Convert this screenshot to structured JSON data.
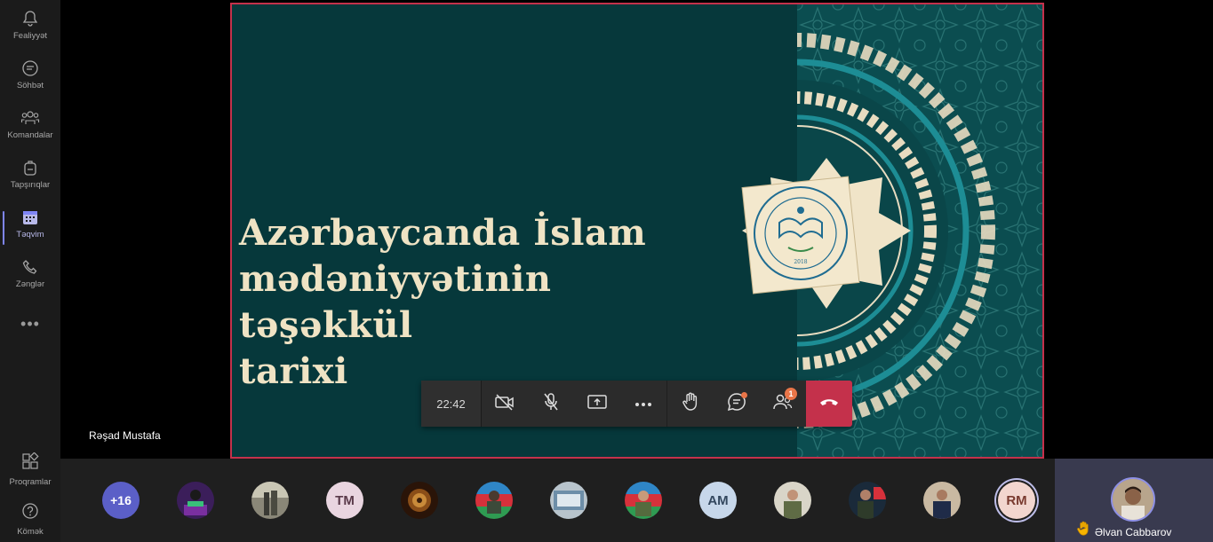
{
  "rail": {
    "items": [
      {
        "label": "Fealiyyət",
        "icon": "bell-icon"
      },
      {
        "label": "Söhbət",
        "icon": "chat-icon"
      },
      {
        "label": "Komandalar",
        "icon": "teams-icon"
      },
      {
        "label": "Tapşırıqlar",
        "icon": "backpack-icon"
      },
      {
        "label": "Təqvim",
        "icon": "calendar-icon"
      },
      {
        "label": "Zənglər",
        "icon": "phone-icon"
      }
    ],
    "more": "•••",
    "bottom": [
      {
        "label": "Proqramlar",
        "icon": "apps-icon"
      },
      {
        "label": "Kömək",
        "icon": "help-icon"
      }
    ]
  },
  "slide": {
    "title_line1": "Azərbaycanda İslam",
    "title_line2": "mədəniyyətinin təşəkkül",
    "title_line3": "tarixi",
    "logo_top_text": "AZƏRBAYCAN İLAHİYYAT İNSTİTUTU",
    "logo_bottom_text": "AZERBAIJAN INSTITUTE OF THEOLOGY",
    "logo_year": "2018"
  },
  "presenter": {
    "name": "Rəşad Mustafa"
  },
  "controls": {
    "timer": "22:42",
    "chat_badge": "",
    "participants_badge": "1"
  },
  "participants": {
    "overflow": "+16",
    "tm": "TM",
    "am": "AM",
    "rm": "RM"
  },
  "self": {
    "name": "Əlvan Cabbarov"
  },
  "colors": {
    "accent": "#7f85f5",
    "hangup": "#c4314b",
    "slide_bg": "#06383b",
    "title": "#efe3c4"
  }
}
